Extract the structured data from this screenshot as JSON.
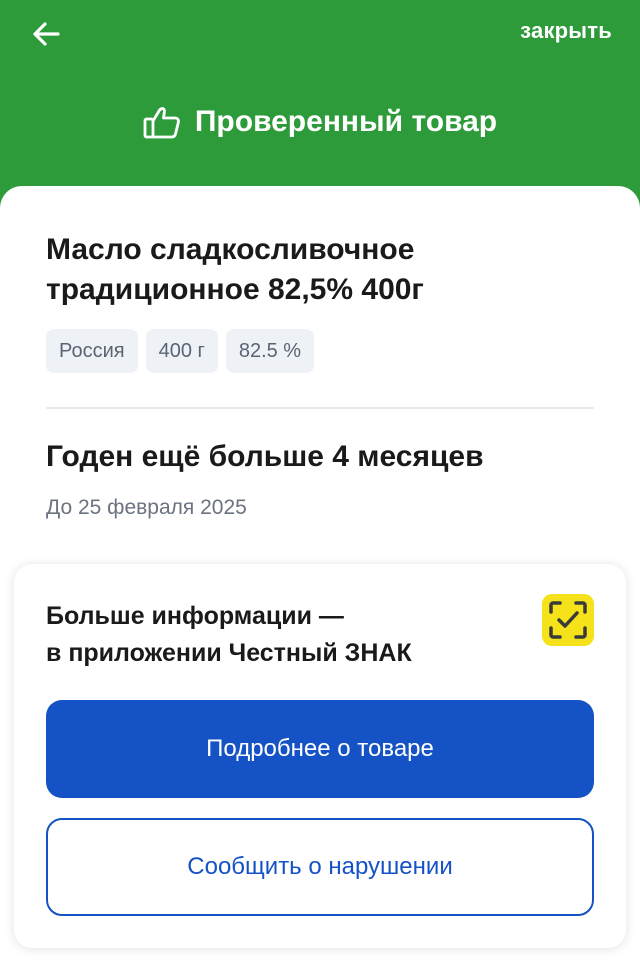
{
  "header": {
    "back_icon": "arrow-left-icon",
    "close_label": "закрыть",
    "title_icon": "thumbs-up-icon",
    "title": "Проверенный товар"
  },
  "product": {
    "name": "Масло сладкосливочное традиционное 82,5% 400г",
    "tags": [
      "Россия",
      "400 г",
      "82.5 %"
    ]
  },
  "expiry": {
    "title": "Годен ещё больше 4 месяцев",
    "date": "До 25 февраля 2025"
  },
  "info_card": {
    "line1": "Больше информации —",
    "line2": "в приложении Честный ЗНАК",
    "app_icon": "chestny-znak-scan-icon",
    "primary_button": "Подробнее о товаре",
    "secondary_button": "Сообщить о нарушении"
  },
  "colors": {
    "header_green": "#2e9b3a",
    "primary_blue": "#1552c6",
    "brand_yellow": "#f5e21a"
  }
}
